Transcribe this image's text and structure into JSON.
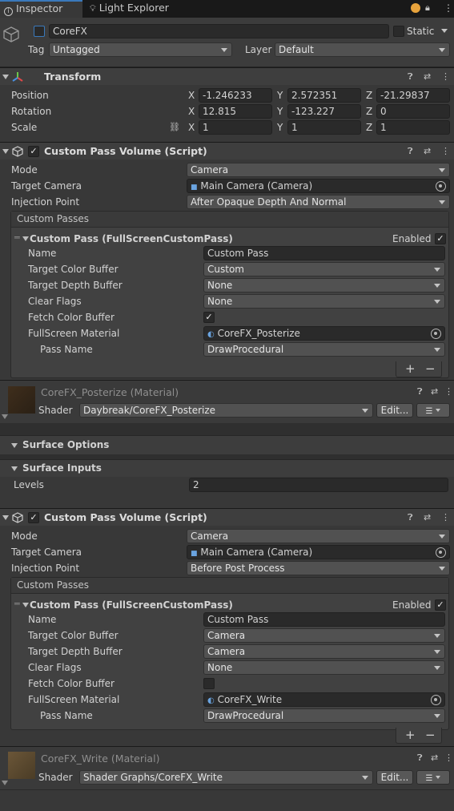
{
  "tabs": {
    "inspector": "Inspector",
    "light_explorer": "Light Explorer"
  },
  "object": {
    "name": "CoreFX",
    "static_label": "Static",
    "tag_label": "Tag",
    "tag_value": "Untagged",
    "layer_label": "Layer",
    "layer_value": "Default"
  },
  "transform": {
    "title": "Transform",
    "position_label": "Position",
    "rotation_label": "Rotation",
    "scale_label": "Scale",
    "axis_x": "X",
    "axis_y": "Y",
    "axis_z": "Z",
    "position": [
      "-1.246233",
      "2.572351",
      "-21.29837"
    ],
    "rotation": [
      "12.815",
      "-123.227",
      "0"
    ],
    "scale": [
      "1",
      "1",
      "1"
    ]
  },
  "volume1": {
    "title": "Custom Pass Volume (Script)",
    "mode_label": "Mode",
    "mode_value": "Camera",
    "camera_label": "Target Camera",
    "camera_value": "Main Camera (Camera)",
    "injection_label": "Injection Point",
    "injection_value": "After Opaque Depth And Normal",
    "custom_passes_label": "Custom Passes",
    "pass_title": "Custom Pass (FullScreenCustomPass)",
    "enabled_label": "Enabled",
    "name_label": "Name",
    "name_value": "Custom Pass",
    "color_buffer_label": "Target Color Buffer",
    "color_buffer_value": "Custom",
    "depth_buffer_label": "Target Depth Buffer",
    "depth_buffer_value": "None",
    "clear_flags_label": "Clear Flags",
    "clear_flags_value": "None",
    "fetch_label": "Fetch Color Buffer",
    "fetch_checked": "✓",
    "material_label": "FullScreen Material",
    "material_value": "CoreFX_Posterize",
    "passname_label": "Pass Name",
    "passname_value": "DrawProcedural",
    "plus": "+",
    "minus": "−"
  },
  "material1": {
    "title": "CoreFX_Posterize (Material)",
    "shader_label": "Shader",
    "shader_value": "Daybreak/CoreFX_Posterize",
    "edit_label": "Edit...",
    "surface_options": "Surface Options",
    "surface_inputs": "Surface Inputs",
    "levels_label": "Levels",
    "levels_value": "2"
  },
  "volume2": {
    "title": "Custom Pass Volume (Script)",
    "mode_label": "Mode",
    "mode_value": "Camera",
    "camera_label": "Target Camera",
    "camera_value": "Main Camera (Camera)",
    "injection_label": "Injection Point",
    "injection_value": "Before Post Process",
    "custom_passes_label": "Custom Passes",
    "pass_title": "Custom Pass (FullScreenCustomPass)",
    "enabled_label": "Enabled",
    "name_label": "Name",
    "name_value": "Custom Pass",
    "color_buffer_label": "Target Color Buffer",
    "color_buffer_value": "Camera",
    "depth_buffer_label": "Target Depth Buffer",
    "depth_buffer_value": "Camera",
    "clear_flags_label": "Clear Flags",
    "clear_flags_value": "None",
    "fetch_label": "Fetch Color Buffer",
    "fetch_checked": "",
    "material_label": "FullScreen Material",
    "material_value": "CoreFX_Write",
    "passname_label": "Pass Name",
    "passname_value": "DrawProcedural",
    "plus": "+",
    "minus": "−"
  },
  "material2": {
    "title": "CoreFX_Write (Material)",
    "shader_label": "Shader",
    "shader_value": "Shader Graphs/CoreFX_Write",
    "edit_label": "Edit..."
  },
  "colors": {
    "accent": "#3a79bb",
    "orange_dot": "#e8a33c"
  }
}
